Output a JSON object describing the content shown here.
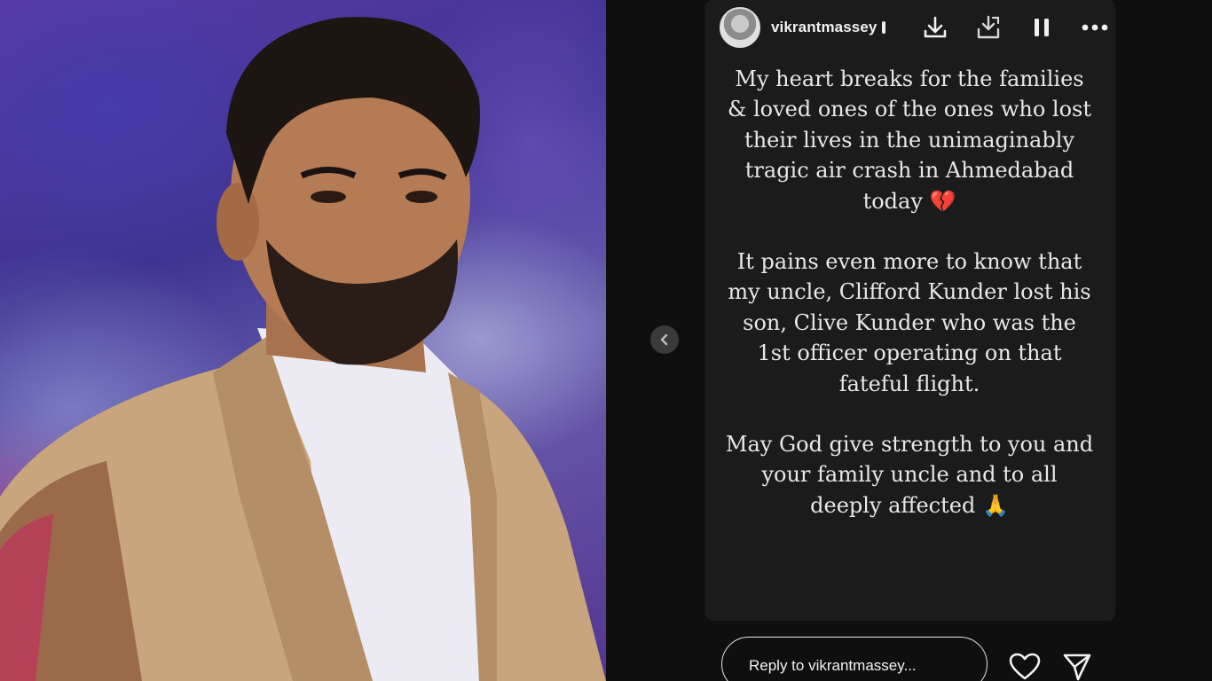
{
  "story": {
    "username": "vikrantmassey",
    "paragraphs": [
      "My heart breaks for the families & loved ones of the ones who lost their lives in the unimaginably tragic air crash in Ahmedabad today 💔",
      "It pains even more to know that my uncle, Clifford Kunder lost his son, Clive Kunder who was the 1st officer operating on that fateful flight.",
      "May God give strength to you and your family uncle and to all deeply affected 🙏"
    ],
    "reply_placeholder": "Reply to vikrantmassey..."
  },
  "icons": {
    "download": "download-icon",
    "save": "save-icon",
    "pause": "pause-icon",
    "more": "more-options-icon",
    "previous": "chevron-left-icon",
    "like": "heart-icon",
    "share": "send-icon"
  },
  "colors": {
    "story_background": "#1b1b1b",
    "page_background": "#0f0f0f",
    "text": "#e8e8e8"
  }
}
